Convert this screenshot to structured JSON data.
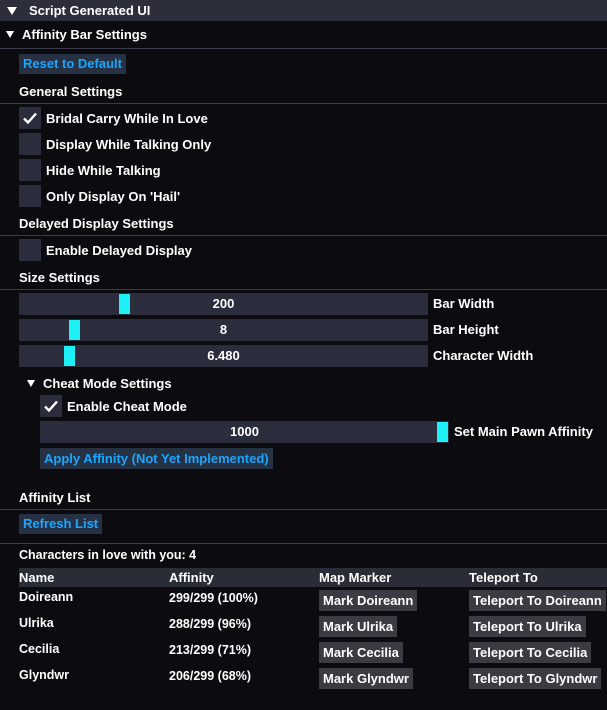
{
  "window": {
    "title": "Script Generated UI"
  },
  "affinity_bar": {
    "header": "Affinity Bar Settings",
    "reset_label": "Reset to Default",
    "general": {
      "title": "General Settings",
      "options": [
        {
          "label": "Bridal Carry While In Love",
          "checked": true
        },
        {
          "label": "Display While Talking Only",
          "checked": false
        },
        {
          "label": "Hide While Talking",
          "checked": false
        },
        {
          "label": "Only Display On 'Hail'",
          "checked": false
        }
      ]
    },
    "delayed": {
      "title": "Delayed Display Settings",
      "options": [
        {
          "label": "Enable Delayed Display",
          "checked": false
        }
      ]
    },
    "size": {
      "title": "Size Settings",
      "sliders": [
        {
          "label": "Bar Width",
          "value": "200"
        },
        {
          "label": "Bar Height",
          "value": "8"
        },
        {
          "label": "Character Width",
          "value": "6.480"
        }
      ]
    },
    "cheat": {
      "header": "Cheat Mode Settings",
      "enable_label": "Enable Cheat Mode",
      "enable_checked": true,
      "slider_value": "1000",
      "slider_label": "Set Main Pawn Affinity",
      "apply_label": "Apply Affinity (Not Yet Implemented)"
    }
  },
  "affinity_list": {
    "title": "Affinity List",
    "refresh_label": "Refresh List",
    "count_text": "Characters in love with you: 4",
    "columns": [
      "Name",
      "Affinity",
      "Map Marker",
      "Teleport To"
    ],
    "rows": [
      {
        "name": "Doireann",
        "affinity": "299/299 (100%)",
        "marker": "Mark Doireann",
        "teleport": "Teleport To Doireann"
      },
      {
        "name": "Ulrika",
        "affinity": "288/299 (96%)",
        "marker": "Mark Ulrika",
        "teleport": "Teleport To Ulrika"
      },
      {
        "name": "Cecilia",
        "affinity": "213/299 (71%)",
        "marker": "Mark Cecilia",
        "teleport": "Teleport To Cecilia"
      },
      {
        "name": "Glyndwr",
        "affinity": "206/299 (68%)",
        "marker": "Mark Glyndwr",
        "teleport": "Teleport To Glyndwr"
      }
    ]
  },
  "colors": {
    "accent": "#1aa6ff",
    "slider_knob": "#1ef0f5",
    "panel": "#2b2d3d",
    "background": "#0c0c10"
  }
}
